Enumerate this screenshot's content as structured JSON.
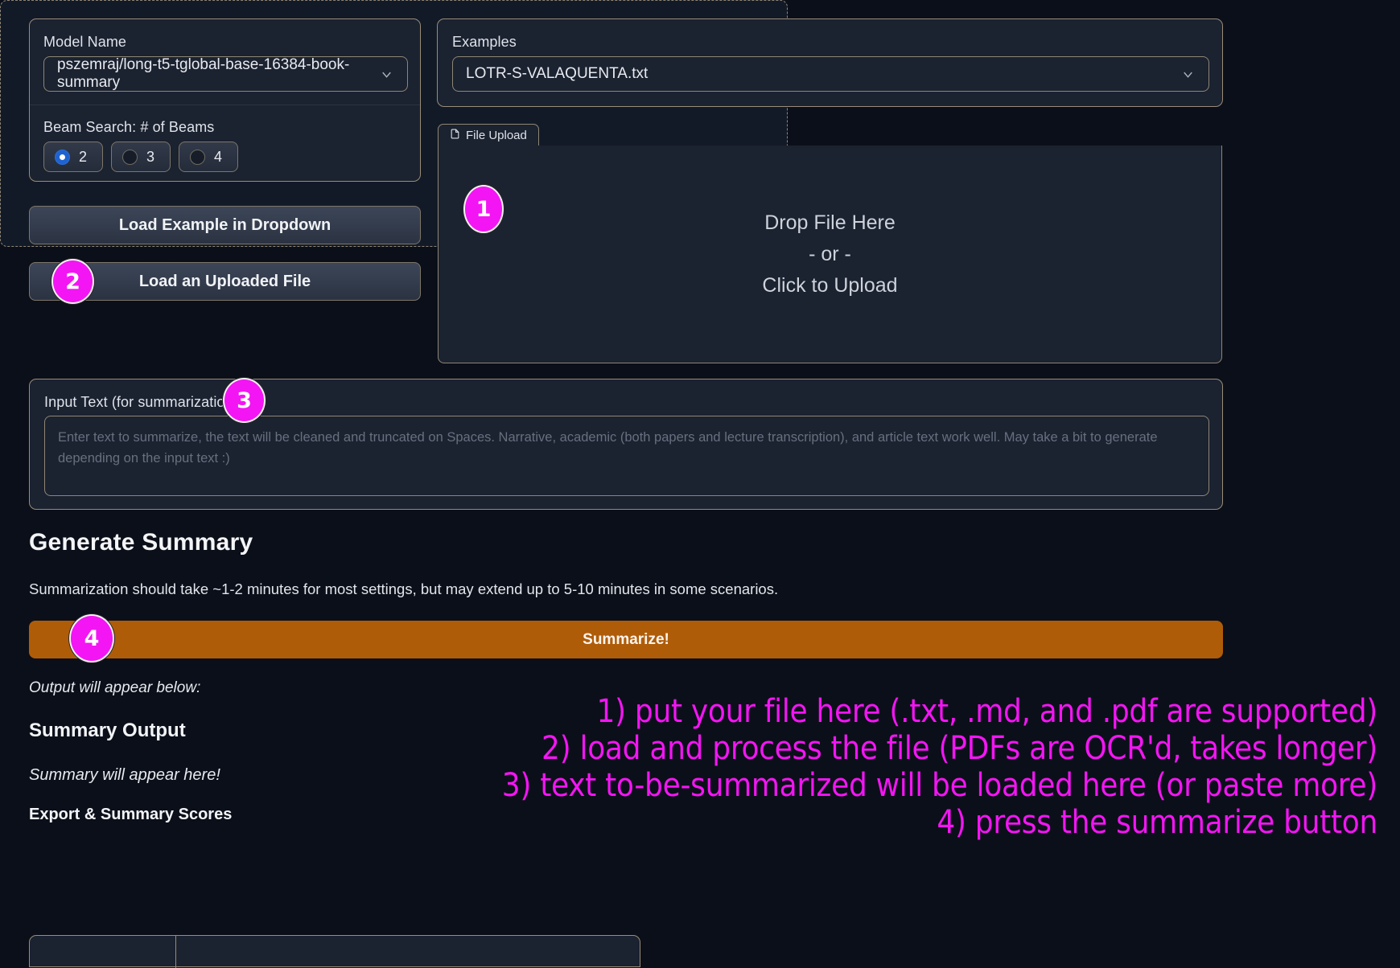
{
  "left": {
    "model_label": "Model Name",
    "model_value": "pszemraj/long-t5-tglobal-base-16384-book-summary",
    "beams_label": "Beam Search: # of Beams",
    "beam_options": [
      {
        "label": "2",
        "selected": true
      },
      {
        "label": "3",
        "selected": false
      },
      {
        "label": "4",
        "selected": false
      }
    ],
    "load_example_label": "Load Example in Dropdown",
    "load_file_label": "Load an Uploaded File"
  },
  "right": {
    "examples_label": "Examples",
    "examples_value": "LOTR-S-VALAQUENTA.txt",
    "file_upload_tab": "File Upload",
    "drop_line_1": "Drop File Here",
    "drop_line_2": "- or -",
    "drop_line_3": "Click to Upload"
  },
  "input": {
    "label": "Input Text (for summarization)",
    "placeholder": "Enter text to summarize, the text will be cleaned and truncated on Spaces. Narrative, academic (both papers and lecture transcription), and article text work well. May take a bit to generate depending on the input text :)"
  },
  "generate": {
    "heading": "Generate Summary",
    "note": "Summarization should take ~1-2 minutes for most settings, but may extend up to 5-10 minutes in some scenarios.",
    "summarize_label": "Summarize!",
    "accent_color": "#af5c09"
  },
  "output": {
    "output_note": "Output will appear below:",
    "summary_heading": "Summary Output",
    "summary_placeholder": "Summary will appear here!",
    "export_heading": "Export & Summary Scores"
  },
  "callouts": [
    {
      "number": "1"
    },
    {
      "number": "2"
    },
    {
      "number": "3"
    },
    {
      "number": "4"
    }
  ],
  "annotations": {
    "color": "#f315f3",
    "lines": [
      "1) put your file here (.txt, .md, and .pdf are supported)",
      "2) load and process the file (PDFs are OCR'd, takes longer)",
      "3) text to-be-summarized will be loaded here (or paste more)",
      "4) press the summarize button"
    ]
  },
  "icons": {
    "chevron_down": "chevron-down-icon",
    "file": "file-icon"
  }
}
